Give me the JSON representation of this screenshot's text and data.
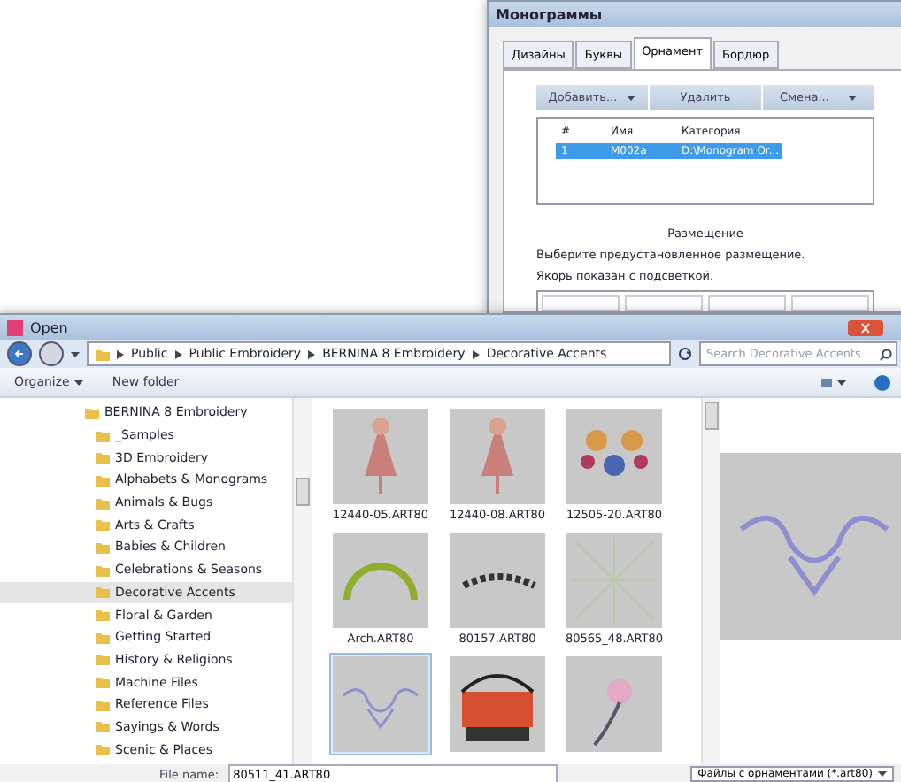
{
  "monogram_window": {
    "title": "Монограммы",
    "tabs": [
      {
        "label": "Дизайны",
        "selected": false
      },
      {
        "label": "Буквы",
        "selected": false
      },
      {
        "label": "Орнамент",
        "selected": true
      },
      {
        "label": "Бордюр",
        "selected": false
      }
    ],
    "buttons": [
      {
        "label": "Добавить...",
        "dropdown": true
      },
      {
        "label": "Удалить",
        "dropdown": false
      },
      {
        "label": "Смена...",
        "dropdown": true
      }
    ],
    "table": {
      "columns": [
        "#",
        "Имя",
        "Категория"
      ],
      "rows": [
        {
          "cells": [
            "1",
            "M002a",
            "D:\\Monogram Or..."
          ],
          "selected": true
        }
      ]
    },
    "placement": {
      "title": "Размещение",
      "hint": "Выберите предустановленное размещение.",
      "note": "Якорь показан с подсветкой."
    }
  },
  "open_window": {
    "title": "Open",
    "breadcrumb": [
      "Public",
      "Public Embroidery",
      "BERNINA 8 Embroidery",
      "Decorative Accents"
    ],
    "search": {
      "placeholder": "Search Decorative Accents"
    },
    "toolbar": {
      "organize": "Organize",
      "new_folder": "New folder"
    },
    "tree": [
      {
        "label": "BERNINA 8 Embroidery",
        "selected": false,
        "children": [
          {
            "label": "_Samples",
            "selected": false
          },
          {
            "label": "3D Embroidery",
            "selected": false
          },
          {
            "label": "Alphabets & Monograms",
            "selected": false
          },
          {
            "label": "Animals & Bugs",
            "selected": false
          },
          {
            "label": "Arts & Crafts",
            "selected": false
          },
          {
            "label": "Babies & Children",
            "selected": false
          },
          {
            "label": "Celebrations & Seasons",
            "selected": false
          },
          {
            "label": "Decorative Accents",
            "selected": true
          },
          {
            "label": "Floral & Garden",
            "selected": false
          },
          {
            "label": "Getting Started",
            "selected": false
          },
          {
            "label": "History & Religions",
            "selected": false
          },
          {
            "label": "Machine Files",
            "selected": false
          },
          {
            "label": "Reference Files",
            "selected": false
          },
          {
            "label": "Sayings & Words",
            "selected": false
          },
          {
            "label": "Scenic & Places",
            "selected": false
          }
        ]
      }
    ],
    "files": [
      {
        "name": "12440-05.ART80",
        "kind": "figure",
        "selected": false
      },
      {
        "name": "12440-08.ART80",
        "kind": "figure",
        "selected": false
      },
      {
        "name": "12505-20.ART80",
        "kind": "flowers",
        "selected": false
      },
      {
        "name": "Arch.ART80",
        "kind": "arch",
        "selected": false
      },
      {
        "name": "80157.ART80",
        "kind": "branch",
        "selected": false
      },
      {
        "name": "80565_48.ART80",
        "kind": "pattern",
        "selected": false
      },
      {
        "kind": "ornament",
        "selected": true
      },
      {
        "kind": "crown",
        "selected": false
      },
      {
        "kind": "flower",
        "selected": false
      }
    ],
    "file_name": {
      "label": "File name:",
      "value": "80511_41.ART80"
    },
    "file_type": "Файлы с орнаментами (*.art80)"
  }
}
